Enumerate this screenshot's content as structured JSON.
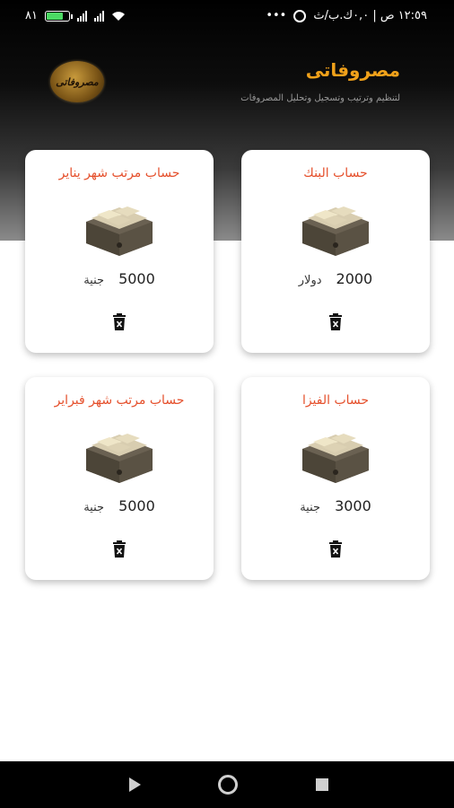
{
  "status_bar": {
    "time": "١٢:٥٩ ص | ٠,٠ك.ب/ث",
    "dots": "•••",
    "battery_level": "٨١",
    "colors": {
      "battery_fill": "#4cd964"
    }
  },
  "header": {
    "title": "مصروفاتى",
    "subtitle": "لتنظيم وترتيب وتسجيل وتحليل المصروفات",
    "logo_icon": "app-logo-seal",
    "logo_text": "مصروفاتى"
  },
  "accounts": [
    {
      "title": "حساب البنك",
      "amount": "2000",
      "currency": "دولار",
      "icon": "money-box-icon"
    },
    {
      "title": "حساب مرتب شهر يناير",
      "amount": "5000",
      "currency": "جنية",
      "icon": "money-box-icon"
    },
    {
      "title": "حساب الفيزا",
      "amount": "3000",
      "currency": "جنية",
      "icon": "money-box-icon"
    },
    {
      "title": "حساب مرتب شهر فبراير",
      "amount": "5000",
      "currency": "جنية",
      "icon": "money-box-icon"
    }
  ],
  "colors": {
    "title_accent": "#f0a11a",
    "card_title": "#e5502c"
  },
  "nav": {
    "back_icon": "back-triangle-icon",
    "home_icon": "home-circle-icon",
    "recent_icon": "recent-square-icon"
  }
}
